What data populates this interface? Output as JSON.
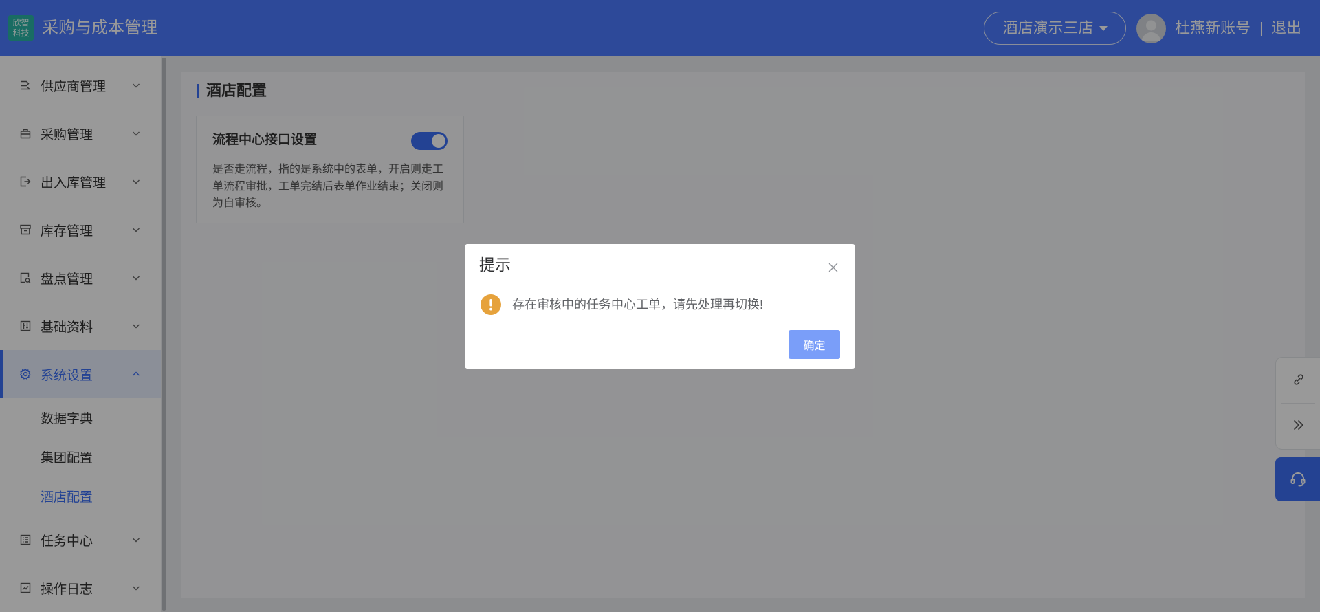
{
  "header": {
    "logo_text": [
      "欣智",
      "科技"
    ],
    "title": "采购与成本管理",
    "store_selector": {
      "value": "酒店演示三店",
      "icon": "caret-down-icon"
    },
    "avatar_icon": "user-avatar-icon",
    "user_name": "杜燕新账号",
    "separator": "|",
    "logout": "退出"
  },
  "sidebar": {
    "items": [
      {
        "label": "供应商管理",
        "icon": "supplier-icon",
        "expanded": false
      },
      {
        "label": "采购管理",
        "icon": "purchase-bag-icon",
        "expanded": false
      },
      {
        "label": "出入库管理",
        "icon": "in-out-icon",
        "expanded": false
      },
      {
        "label": "库存管理",
        "icon": "inventory-box-icon",
        "expanded": false
      },
      {
        "label": "盘点管理",
        "icon": "stocktake-icon",
        "expanded": false
      },
      {
        "label": "基础资料",
        "icon": "basic-data-icon",
        "expanded": false
      },
      {
        "label": "系统设置",
        "icon": "gear-icon",
        "expanded": true,
        "active": true,
        "children": [
          {
            "label": "数据字典",
            "active": false
          },
          {
            "label": "集团配置",
            "active": false
          },
          {
            "label": "酒店配置",
            "active": true
          }
        ]
      },
      {
        "label": "任务中心",
        "icon": "task-list-icon",
        "expanded": false
      },
      {
        "label": "操作日志",
        "icon": "log-chart-icon",
        "expanded": false
      }
    ]
  },
  "main": {
    "page_title": "酒店配置",
    "cards": [
      {
        "title": "流程中心接口设置",
        "switch_on": true,
        "description_lines": [
          "是否走流程，指的是系统中的表单，开启则走工",
          "单流程审批，工单完结后表单作业结束；关闭则",
          "为自审核。"
        ]
      }
    ]
  },
  "float_toolbar": {
    "icons": [
      "link-icon",
      "double-chevron-right-icon",
      "headset-icon"
    ]
  },
  "dialog": {
    "title": "提示",
    "icon": "warning-icon",
    "message": "存在审核中的任务中心工单，请先处理再切换!",
    "confirm_label": "确定",
    "close_icon": "close-icon"
  },
  "colors": {
    "header": "#4b7bff",
    "accent": "#3b6ff5",
    "warning": "#e6a23c",
    "confirm_button": "#7a9ef9",
    "mask": "rgba(0,0,0,0.4)"
  }
}
